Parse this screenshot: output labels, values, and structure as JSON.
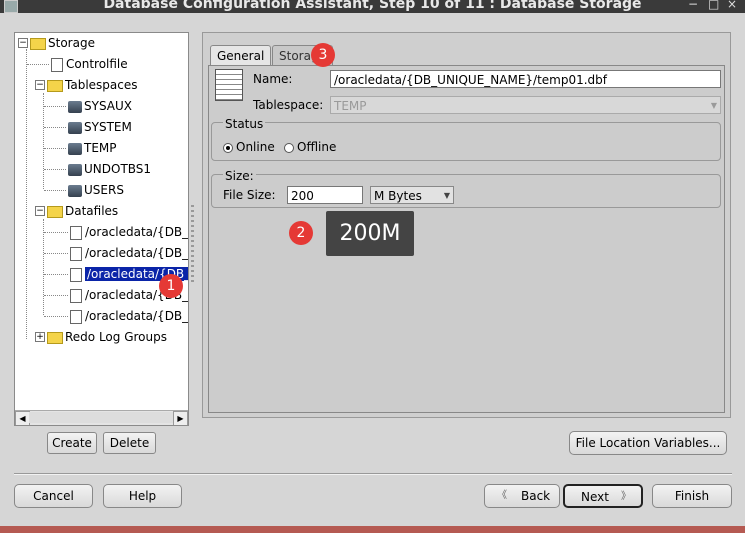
{
  "window": {
    "title": "Database Configuration Assistant, Step 10 of 11 : Database Storage",
    "minimize": "−",
    "maximize": "□",
    "close": "×"
  },
  "tree": {
    "root": "Storage",
    "controlfile": "Controlfile",
    "tablespaces": {
      "label": "Tablespaces",
      "items": [
        "SYSAUX",
        "SYSTEM",
        "TEMP",
        "UNDOTBS1",
        "USERS"
      ]
    },
    "datafiles": {
      "label": "Datafiles",
      "items": [
        "/oracledata/{DB_",
        "/oracledata/{DB_",
        "/oracledata/{DB_",
        "/oracledata/{DB_",
        "/oracledata/{DB_"
      ],
      "selected_index": 2
    },
    "redo": "Redo Log Groups"
  },
  "tabs": {
    "general": "General",
    "storage": "Storage"
  },
  "general": {
    "name_label": "Name:",
    "name_value": "/oracledata/{DB_UNIQUE_NAME}/temp01.dbf",
    "tablespace_label": "Tablespace:",
    "tablespace_value": "TEMP",
    "status_label": "Status",
    "online_label": "Online",
    "offline_label": "Offline",
    "size_group_label": "Size:",
    "file_size_label": "File Size:",
    "file_size_value": "200",
    "unit_value": "M Bytes"
  },
  "buttons": {
    "create": "Create",
    "delete": "Delete",
    "file_location": "File Location Variables...",
    "cancel": "Cancel",
    "help": "Help",
    "back": "Back",
    "next": "Next",
    "finish": "Finish"
  },
  "annotations": {
    "badge1": "1",
    "badge2": "2",
    "badge3": "3",
    "tooltip": "200M"
  },
  "colors": {
    "selection": "#0a24a8",
    "badge": "#e53935",
    "tooltip_bg": "#444444"
  }
}
